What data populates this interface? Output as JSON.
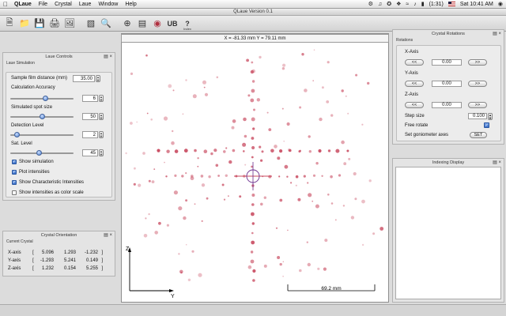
{
  "menubar": {
    "app": "QLaue",
    "items": [
      "File",
      "Crystal",
      "Laue",
      "Window",
      "Help"
    ],
    "battery": "(1:31)",
    "clock": "Sat 10:41 AM"
  },
  "window": {
    "title": "QLaue Version 0.1"
  },
  "toolbar": {
    "ub_label": "UB",
    "index_label": "Index",
    "index_mark": "?"
  },
  "laue_controls": {
    "title": "Laue Controls",
    "section": "Laue Simulation",
    "film_distance_label": "Sample film distance (mm)",
    "film_distance_value": "35.00",
    "calc_accuracy_label": "Calculation Accuracy",
    "calc_accuracy_value": "6",
    "calc_accuracy_frac": 0.55,
    "spot_size_label": "Simulated spot size",
    "spot_size_value": "50",
    "spot_size_frac": 0.5,
    "detection_label": "Detection Level",
    "detection_value": "2",
    "detection_frac": 0.1,
    "sat_label": "Sat. Level",
    "sat_value": "45",
    "sat_frac": 0.45,
    "show_simulation": "Show simulation",
    "plot_intensities": "Plot intensities",
    "show_characteristic": "Show Characteristic Intensities",
    "show_color_scale": "Show intensities as color scale"
  },
  "crystal_orientation": {
    "title": "Crystal Orientation",
    "section": "Current Crystal",
    "rows": [
      {
        "label": "X-axis",
        "bracket": "[",
        "a": "5.096",
        "b": "1.293",
        "c": "-1.232",
        "end": "]"
      },
      {
        "label": "Y-axis",
        "bracket": "[",
        "a": "-1.293",
        "b": "5.241",
        "c": "0.149",
        "end": "]"
      },
      {
        "label": "Z-axis",
        "bracket": "[",
        "a": "1.232",
        "b": "0.154",
        "c": "5.255",
        "end": "]"
      }
    ]
  },
  "crystal_rotations": {
    "title": "Crystal Rotations",
    "section": "Rotations",
    "x_axis": "X-Axis",
    "y_axis": "Y-Axis",
    "z_axis": "Z-Axis",
    "left_btn": "<<",
    "right_btn": ">>",
    "x_value": "0.00",
    "y_value": "0.00",
    "z_value": "0.00",
    "step_label": "Step size",
    "step_value": "0.100",
    "free_rotate": "Free rotate",
    "gonio_label": "Set goniometer axes",
    "set_btn": "SET"
  },
  "indexing": {
    "title": "Indexing Display"
  },
  "viewer": {
    "coords": "X = -81.33 mm  Y = 79.11 mm",
    "scale_label": "69.2 mm",
    "axis_z": "Z",
    "axis_y": "Y"
  },
  "colors": {
    "spot": "#c8485e",
    "marker": "#6a2c8c",
    "accent": "#3b6ec7"
  }
}
